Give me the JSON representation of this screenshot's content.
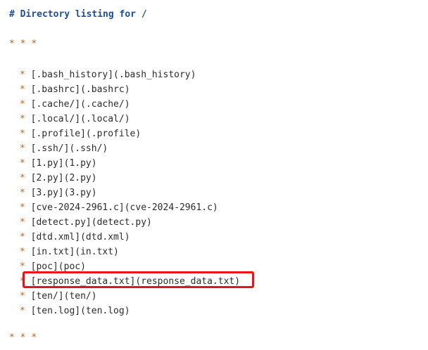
{
  "heading": "# Directory listing for /",
  "separator_top": "* * *",
  "separator_bottom": "* * *",
  "bullet": "*",
  "items": [
    "[.bash_history](.bash_history)",
    "[.bashrc](.bashrc)",
    "[.cache/](.cache/)",
    "[.local/](.local/)",
    "[.profile](.profile)",
    "[.ssh/](.ssh/)",
    "[1.py](1.py)",
    "[2.py](2.py)",
    "[3.py](3.py)",
    "[cve-2024-2961.c](cve-2024-2961.c)",
    "[detect.py](detect.py)",
    "[dtd.xml](dtd.xml)",
    "[in.txt](in.txt)",
    "[poc](poc)",
    "[response_data.txt](response_data.txt)",
    "[ten/](ten/)",
    "[ten.log](ten.log)"
  ],
  "highlighted_item": "[response_data.txt](response_data.txt)",
  "colors": {
    "heading": "#1d4e9a",
    "bullet": "#b5651d",
    "text": "#2b2b2b",
    "highlight_border": "#e8131b"
  }
}
